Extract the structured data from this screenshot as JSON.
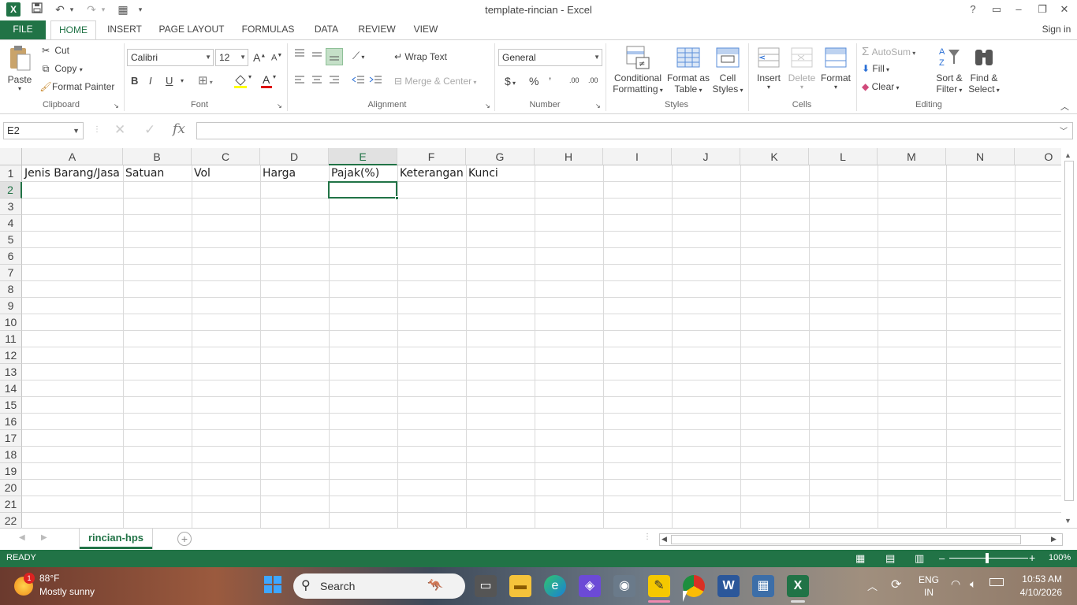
{
  "window": {
    "title": "template-rincian - Excel",
    "help": "?",
    "ribbon_display": "▭",
    "minimize": "–",
    "restore": "❐",
    "close": "✕",
    "sign_in": "Sign in"
  },
  "qat": {
    "app": "X",
    "save": "💾",
    "undo": "↶",
    "redo": "↷",
    "form": "▦",
    "customize": "▾"
  },
  "tabs": [
    "FILE",
    "HOME",
    "INSERT",
    "PAGE LAYOUT",
    "FORMULAS",
    "DATA",
    "REVIEW",
    "VIEW"
  ],
  "ribbon": {
    "clipboard": {
      "paste": "Paste",
      "cut": "Cut",
      "copy": "Copy",
      "format_painter": "Format Painter",
      "label": "Clipboard"
    },
    "font": {
      "name": "Calibri",
      "size": "12",
      "bold": "B",
      "italic": "I",
      "underline": "U",
      "grow": "A",
      "shrink": "A",
      "label": "Font"
    },
    "alignment": {
      "wrap_text": "Wrap Text",
      "merge_center": "Merge & Center",
      "label": "Alignment"
    },
    "number": {
      "format": "General",
      "currency": "$",
      "percent": "%",
      "comma": "’",
      "inc_dec": ".00",
      "label": "Number"
    },
    "styles": {
      "conditional_1": "Conditional",
      "conditional_2": "Formatting",
      "format_table_1": "Format as",
      "format_table_2": "Table",
      "cell_styles_1": "Cell",
      "cell_styles_2": "Styles",
      "label": "Styles"
    },
    "cells": {
      "insert": "Insert",
      "delete": "Delete",
      "format": "Format",
      "label": "Cells"
    },
    "editing": {
      "autosum": "AutoSum",
      "fill": "Fill",
      "clear": "Clear",
      "sort_1": "Sort &",
      "sort_2": "Filter",
      "find_1": "Find &",
      "find_2": "Select",
      "label": "Editing"
    }
  },
  "formula_bar": {
    "name_box": "E2",
    "cancel": "✕",
    "enter": "✓",
    "fx": "fx",
    "value": ""
  },
  "columns": [
    "A",
    "B",
    "C",
    "D",
    "E",
    "F",
    "G",
    "H",
    "I",
    "J",
    "K",
    "L",
    "M",
    "N",
    "O"
  ],
  "rows": [
    "1",
    "2",
    "3",
    "4",
    "5",
    "6",
    "7",
    "8",
    "9",
    "10",
    "11",
    "12",
    "13",
    "14",
    "15",
    "16",
    "17",
    "18",
    "19",
    "20",
    "21",
    "22"
  ],
  "cells": {
    "A1": "Jenis Barang/Jasa",
    "B1": "Satuan",
    "C1": "Vol",
    "D1": "Harga",
    "E1": "Pajak(%)",
    "F1": "Keterangan",
    "G1": "Kunci"
  },
  "selected_cell": "E2",
  "sheets": {
    "active": "rincian-hps",
    "add": "+"
  },
  "status": {
    "mode": "READY",
    "zoom": "100%"
  },
  "taskbar": {
    "weather_temp": "88°F",
    "weather_desc": "Mostly sunny",
    "weather_badge": "1",
    "search": "Search",
    "lang_1": "ENG",
    "lang_2": "IN",
    "time": "10:53 AM",
    "date": "4/10/2026"
  },
  "colors": {
    "excel_green": "#217346"
  }
}
